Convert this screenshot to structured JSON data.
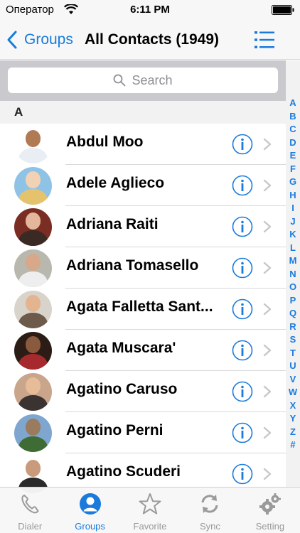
{
  "status_bar": {
    "carrier": "Оператор",
    "time": "6:11 PM"
  },
  "nav": {
    "back_label": "Groups",
    "title": "All Contacts (1949)"
  },
  "search": {
    "placeholder": "Search"
  },
  "section_letter": "A",
  "index_letters": [
    "A",
    "B",
    "C",
    "D",
    "E",
    "F",
    "G",
    "H",
    "I",
    "J",
    "K",
    "L",
    "M",
    "N",
    "O",
    "P",
    "Q",
    "R",
    "S",
    "T",
    "U",
    "V",
    "W",
    "X",
    "Y",
    "Z",
    "#"
  ],
  "contacts": [
    {
      "name": "Abdul Moo",
      "avatar_bg": "#ffffff",
      "skin": "#b07a55",
      "clothes": "#e9eef4"
    },
    {
      "name": "Adele Aglieco",
      "avatar_bg": "#8fc3e6",
      "skin": "#f1d2b4",
      "clothes": "#e5c36d"
    },
    {
      "name": "Adriana Raiti",
      "avatar_bg": "#7a2d22",
      "skin": "#e4b79d",
      "clothes": "#3a2a24"
    },
    {
      "name": "Adriana Tomasello",
      "avatar_bg": "#b8b8ae",
      "skin": "#d7a88a",
      "clothes": "#eeeeee"
    },
    {
      "name": "Agata Falletta Sant...",
      "avatar_bg": "#d9d4cb",
      "skin": "#e3b48f",
      "clothes": "#6d5a4b"
    },
    {
      "name": "Agata Muscara'",
      "avatar_bg": "#2b1c16",
      "skin": "#8a5a3e",
      "clothes": "#a6292d"
    },
    {
      "name": "Agatino Caruso",
      "avatar_bg": "#c9a58b",
      "skin": "#e7bc98",
      "clothes": "#3b3331"
    },
    {
      "name": "Agatino Perni",
      "avatar_bg": "#7fa6cf",
      "skin": "#9a7b5e",
      "clothes": "#3f6b34"
    },
    {
      "name": "Agatino Scuderi",
      "avatar_bg": "#ffffff",
      "skin": "#c99a7b",
      "clothes": "#2a2a2a"
    }
  ],
  "tabs": [
    {
      "label": "Dialer",
      "icon": "phone-icon"
    },
    {
      "label": "Groups",
      "icon": "groups-icon"
    },
    {
      "label": "Favorite",
      "icon": "star-icon"
    },
    {
      "label": "Sync",
      "icon": "sync-icon"
    },
    {
      "label": "Setting",
      "icon": "gears-icon"
    }
  ],
  "colors": {
    "accent": "#1a7bdc",
    "inactive_tab": "#9a9a9a",
    "search_bg": "#c9c9ce"
  }
}
